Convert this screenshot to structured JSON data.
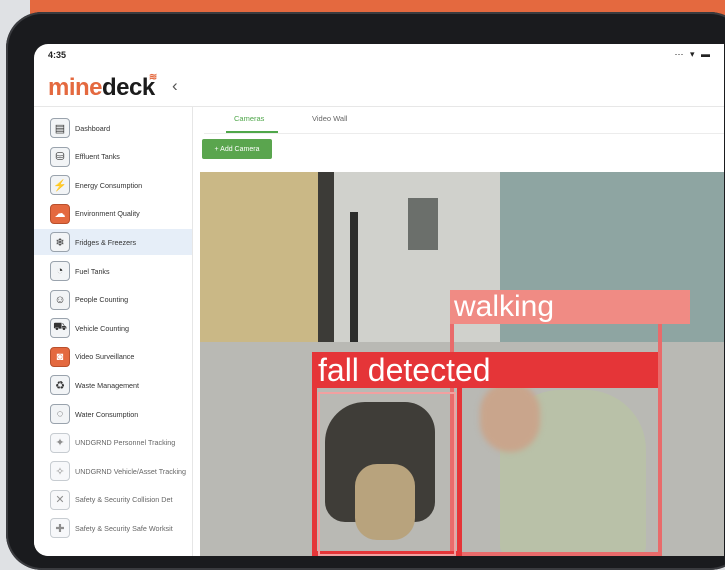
{
  "status": {
    "time": "4:35",
    "icons": "⋯ ▾ ▬"
  },
  "app": {
    "logo_part1": "mine",
    "logo_part2": "deck",
    "collapse_icon": "‹"
  },
  "sidebar": {
    "items": [
      {
        "label": "Dashboard",
        "icon": "dashboard-icon",
        "glyph": "▤"
      },
      {
        "label": "Effluent Tanks",
        "icon": "tank-icon",
        "glyph": "⛁"
      },
      {
        "label": "Energy Consumption",
        "icon": "energy-icon",
        "glyph": "⚡"
      },
      {
        "label": "Environment Quality",
        "icon": "environment-icon",
        "glyph": "☁"
      },
      {
        "label": "Fridges & Freezers",
        "icon": "fridge-icon",
        "glyph": "❄"
      },
      {
        "label": "Fuel Tanks",
        "icon": "fuel-gauge-icon",
        "glyph": "◔"
      },
      {
        "label": "People Counting",
        "icon": "people-icon",
        "glyph": "☺"
      },
      {
        "label": "Vehicle Counting",
        "icon": "vehicle-icon",
        "glyph": "⛟"
      },
      {
        "label": "Video Surveillance",
        "icon": "camera-icon",
        "glyph": "◙"
      },
      {
        "label": "Waste Management",
        "icon": "waste-bin-icon",
        "glyph": "♻"
      },
      {
        "label": "Water Consumption",
        "icon": "water-icon",
        "glyph": "◌"
      },
      {
        "label": "UNDGRND Personnel Tracking",
        "icon": "personnel-tracking-icon",
        "glyph": "✦"
      },
      {
        "label": "UNDGRND Vehicle/Asset Tracking",
        "icon": "asset-tracking-icon",
        "glyph": "✧"
      },
      {
        "label": "Safety & Security Collision Det",
        "icon": "collision-icon",
        "glyph": "✕"
      },
      {
        "label": "Safety & Security Safe Worksit",
        "icon": "safe-worksite-icon",
        "glyph": "✚"
      }
    ],
    "active_index": 4
  },
  "tabs": [
    {
      "label": "Cameras"
    },
    {
      "label": "Video Wall"
    }
  ],
  "toolbar": {
    "add_camera": "+ Add Camera"
  },
  "video": {
    "detections": [
      {
        "label": "walking"
      },
      {
        "label": "fall detected"
      }
    ]
  },
  "colors": {
    "brand_orange": "#e4693f",
    "accent_green": "#5aa54e",
    "alert_red": "#e53538",
    "walk_pink": "#f08b84"
  }
}
